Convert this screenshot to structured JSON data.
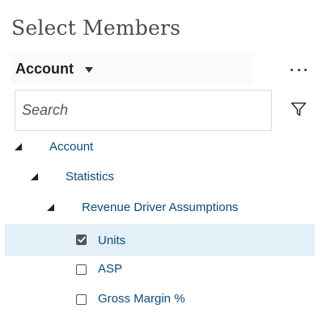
{
  "dialog": {
    "title": "Select Members"
  },
  "dimension": {
    "selected": "Account"
  },
  "search": {
    "placeholder": "Search"
  },
  "tree": {
    "nodes": [
      {
        "label": "Account",
        "level": 0,
        "expanded": true
      },
      {
        "label": "Statistics",
        "level": 1,
        "expanded": true
      },
      {
        "label": "Revenue Driver Assumptions",
        "level": 2,
        "expanded": true
      },
      {
        "label": "Units",
        "level": 3,
        "checked": true,
        "selected": true
      },
      {
        "label": "ASP",
        "level": 3,
        "checked": false
      },
      {
        "label": "Gross Margin %",
        "level": 3,
        "checked": false
      }
    ]
  },
  "icons": {
    "more": "more-horizontal-icon",
    "filter": "filter-icon",
    "expander": "collapse-triangle-icon",
    "dropdown": "caret-down-icon"
  },
  "colors": {
    "link_text": "#0d4a7a",
    "selected_row": "#e4f0f8"
  }
}
